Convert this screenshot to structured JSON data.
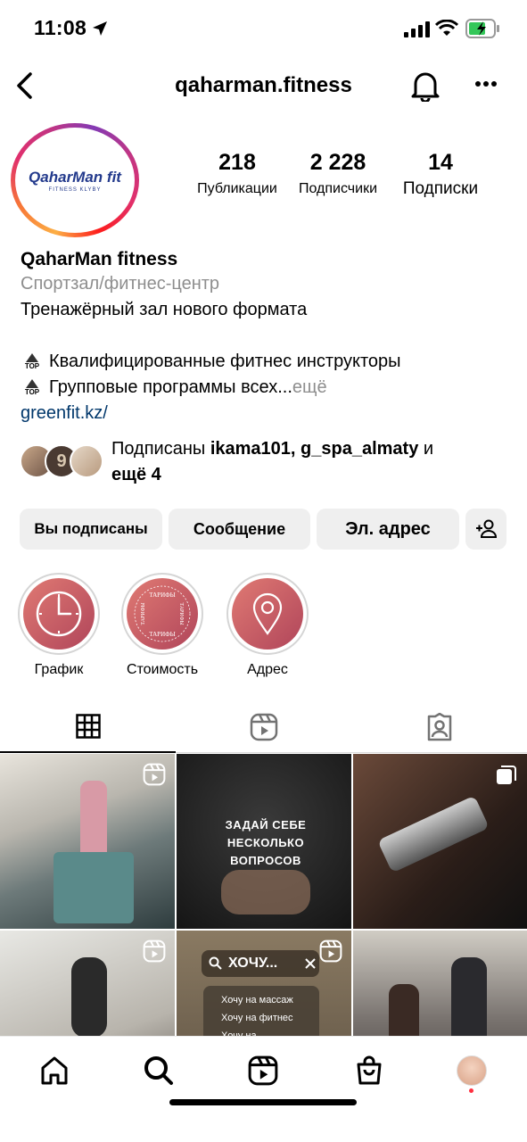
{
  "status_bar": {
    "time": "11:08"
  },
  "header": {
    "username": "qaharman.fitness"
  },
  "profile": {
    "avatar_logo": "QaharMan fit",
    "avatar_logo_sub": "FITNESS KLYBY",
    "stats": [
      {
        "value": "218",
        "label": "Публикации"
      },
      {
        "value": "2 228",
        "label": "Подписчики"
      },
      {
        "value": "14",
        "label": "Подписки"
      }
    ],
    "name": "QaharMan fitness",
    "category": "Спортзал/фитнес-центр",
    "bio_line1": "Тренажёрный зал нового формата",
    "bio_line2": "Квалифицированные фитнес инструкторы",
    "bio_line3": "Групповые программы всех...",
    "bio_more": " ещё",
    "top_badge": "TOP",
    "link": "greenfit.kz/",
    "followed_prefix": "Подписаны ",
    "followed_users": "ikama101, g_spa_almaty",
    "followed_and": " и",
    "followed_more": "ещё 4"
  },
  "buttons": {
    "following": "Вы подписаны",
    "message": "Сообщение",
    "email": "Эл. адрес"
  },
  "highlights": [
    {
      "label": "График",
      "icon": "clock-icon"
    },
    {
      "label": "Стоимость",
      "icon": "price-stamp-icon",
      "stamp_text": "ТАРИФЫ"
    },
    {
      "label": "Адрес",
      "icon": "location-pin-icon"
    }
  ],
  "grid": {
    "post2_text": "ЗАДАЙ СЕБЕ НЕСКОЛЬКО ВОПРОСОВ",
    "post5_search": "ХОЧУ...",
    "post5_suggestions": [
      "Хочу на массаж",
      "Хочу на фитнес",
      "Хочу на..."
    ]
  },
  "colors": {
    "accent_link": "#00376b",
    "button_bg": "#efefef",
    "highlight_grad_start": "#e07a73",
    "highlight_grad_end": "#b0455a"
  }
}
